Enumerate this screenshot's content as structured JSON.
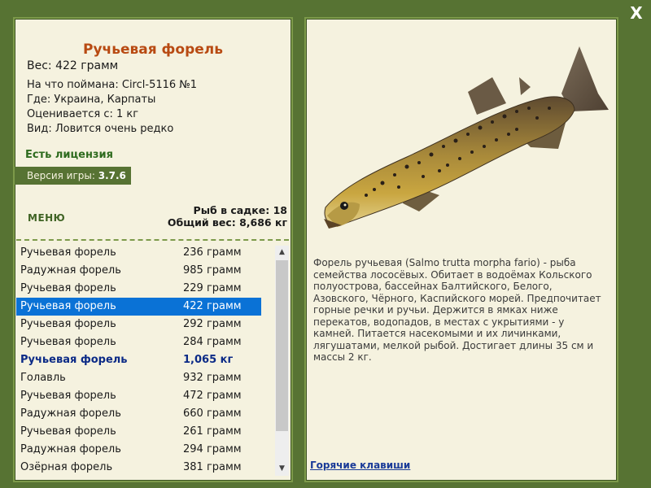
{
  "close_label": "X",
  "fish": {
    "title": "Ручьевая форель",
    "weight_line": "Вес: 422 грамм",
    "caught_on": "На что поймана: Circl-5116 №1",
    "location": "Где: Украина, Карпаты",
    "valued_from": "Оценивается с: 1 кг",
    "rarity": "Вид: Ловится очень редко"
  },
  "license": "Есть лицензия",
  "version": {
    "label": "Версия игры:",
    "value": "3.7.6"
  },
  "menu_label": "МЕНЮ",
  "stats": {
    "count_line": "Рыб в садке: 18",
    "total_line": "Общий вес: 8,686 кг"
  },
  "catch_list": [
    {
      "name": "Ручьевая форель",
      "weight": "236 грамм",
      "state": "normal"
    },
    {
      "name": "Радужная форель",
      "weight": "985 грамм",
      "state": "normal"
    },
    {
      "name": "Ручьевая форель",
      "weight": "229 грамм",
      "state": "normal"
    },
    {
      "name": "Ручьевая форель",
      "weight": "422 грамм",
      "state": "selected"
    },
    {
      "name": "Ручьевая форель",
      "weight": "292 грамм",
      "state": "normal"
    },
    {
      "name": "Ручьевая форель",
      "weight": "284 грамм",
      "state": "normal"
    },
    {
      "name": "Ручьевая форель",
      "weight": "1,065 кг",
      "state": "heavy"
    },
    {
      "name": "Голавль",
      "weight": "932 грамм",
      "state": "normal"
    },
    {
      "name": "Ручьевая форель",
      "weight": "472 грамм",
      "state": "normal"
    },
    {
      "name": "Радужная форель",
      "weight": "660 грамм",
      "state": "normal"
    },
    {
      "name": "Ручьевая форель",
      "weight": "261 грамм",
      "state": "normal"
    },
    {
      "name": "Радужная форель",
      "weight": "294 грамм",
      "state": "normal"
    },
    {
      "name": "Озёрная форель",
      "weight": "381 грамм",
      "state": "normal"
    }
  ],
  "description": "Форель ручьевая (Salmo trutta morpha fario) - рыба семейства лососёвых. Обитает в водоёмах Кольского полуострова, бассейнах Балтийского, Белого, Азовского, Чёрного, Каспийского морей. Предпочитает горные речки и ручьи. Держится в ямках ниже перекатов, водопадов, в местах с укрытиями - у камней. Питается насекомыми и их личинками, лягушатами, мелкой рыбой. Достигает длины 35 см и массы 2 кг.",
  "hotkeys_label": "Горячие клавиши",
  "icons": {
    "scroll_up": "arrow-up-icon",
    "scroll_down": "arrow-down-icon",
    "close": "close-icon"
  },
  "colors": {
    "background": "#577333",
    "panel": "#f5f2df",
    "title": "#b84a12",
    "selection": "#0a72d6",
    "heavy_catch": "#0b2a86",
    "license": "#2e6b1e"
  }
}
